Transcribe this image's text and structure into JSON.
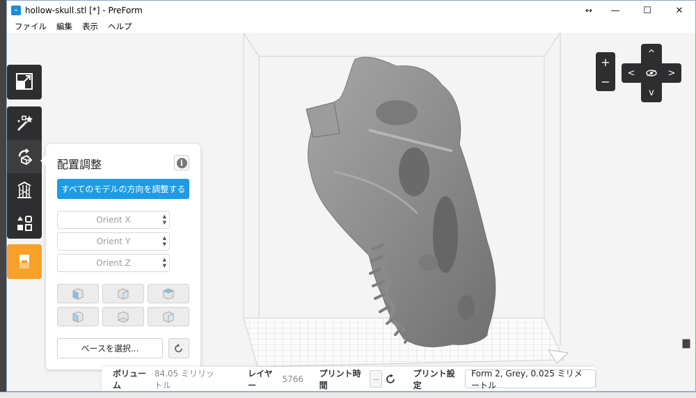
{
  "window": {
    "title": "hollow-skull.stl [*] - PreForm",
    "app_icon": "preform-logo-icon",
    "controls": {
      "resize": "↔",
      "minimize": "—",
      "maximize": "☐",
      "close": "✕"
    }
  },
  "menu": {
    "items": [
      "ファイル",
      "編集",
      "表示",
      "ヘルプ"
    ]
  },
  "toolbar": {
    "buttons": [
      {
        "name": "fit-view",
        "icon": "expand-icon"
      },
      {
        "name": "supports-wizard",
        "icon": "magic-wand-icon"
      },
      {
        "name": "orient",
        "icon": "rotate-icon",
        "active": true
      },
      {
        "name": "supports",
        "icon": "support-structure-icon"
      },
      {
        "name": "layout",
        "icon": "layout-icon"
      },
      {
        "name": "print",
        "icon": "printer-icon",
        "color": "#f7a02a"
      }
    ]
  },
  "orient_panel": {
    "title": "配置調整",
    "info_label": "i",
    "orient_all_button": "すべてのモデルの方向を調整する",
    "orient_x": "Orient X",
    "orient_y": "Orient Y",
    "orient_z": "Orient Z",
    "base_select_button": "ベースを選択...",
    "view_buttons": [
      "view-face-front",
      "view-face-top",
      "view-face-right",
      "view-face-left",
      "view-face-bottom",
      "view-face-back"
    ]
  },
  "statusbar": {
    "volume_label": "ボリューム",
    "volume_value": "84.05 ミリリットル",
    "layers_label": "レイヤー",
    "layers_value": "5766",
    "print_time_label": "プリント時間",
    "print_time_value": "--",
    "print_settings_label": "プリント設定",
    "print_settings_value": "Form 2, Grey, 0.025 ミリメートル"
  },
  "navigation": {
    "zoom_in": "+",
    "zoom_out": "−",
    "up": "^",
    "down": "v",
    "left": "<",
    "right": ">"
  },
  "colors": {
    "accent": "#1e9be6",
    "toolbar_bg": "#2e2e30",
    "print_button": "#f7a02a",
    "model": "#8f8f8f"
  }
}
